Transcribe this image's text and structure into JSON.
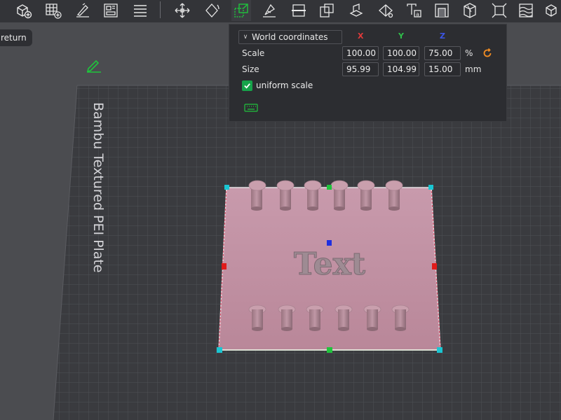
{
  "toolbar": {
    "items": [
      "add-object",
      "add-plate",
      "auto-orient",
      "arrange",
      "split-plates",
      "move",
      "rotate",
      "scale",
      "lay-on-face",
      "cut",
      "boolean",
      "support-paint",
      "seam-paint",
      "color-paint",
      "text",
      "emboss",
      "measure",
      "assembly",
      "mesh",
      "more"
    ]
  },
  "return_pill": {
    "label": "return"
  },
  "plate": {
    "label": "Bambu Textured PEI Plate"
  },
  "model": {
    "text": "Text"
  },
  "scale_panel": {
    "coord_system": "World coordinates",
    "axes": {
      "x": "X",
      "y": "Y",
      "z": "Z"
    },
    "axis_colors": {
      "x": "#e03a3a",
      "y": "#2fbf4a",
      "z": "#3b55e6"
    },
    "scale": {
      "label": "Scale",
      "x": "100.00",
      "y": "100.00",
      "z": "75.00",
      "unit": "%"
    },
    "size": {
      "label": "Size",
      "x": "95.99",
      "y": "104.99",
      "z": "15.00",
      "unit": "mm"
    },
    "uniform_scale": {
      "label": "uniform scale",
      "checked": true
    }
  },
  "colors": {
    "accent": "#16a34a",
    "reset": "#f08c23",
    "handle_cyan": "#19c6d2",
    "handle_green": "#1fc43c",
    "handle_red": "#e01b1b",
    "handle_blue": "#1f2fe0"
  }
}
